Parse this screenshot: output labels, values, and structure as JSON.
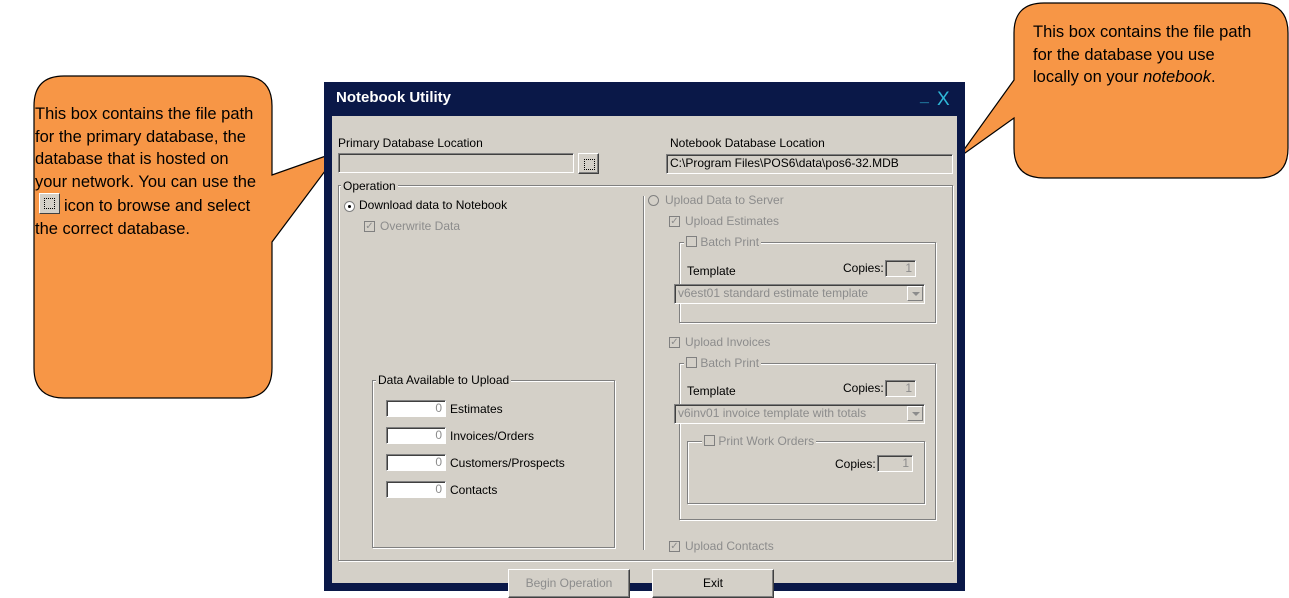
{
  "callouts": {
    "left": {
      "text_before_icon": "This box contains the file path for the primary database, the database that is hosted on your network. You can use the",
      "text_after_icon": "icon to browse and select the correct database.",
      "fill": "#f79646",
      "icon": "browse-icon"
    },
    "right": {
      "text": "This box contains the file path for the database you use locally on your",
      "emphasis": "notebook",
      "suffix": ".",
      "fill": "#f79646"
    }
  },
  "window": {
    "title": "Notebook Utility",
    "minimize": "_",
    "close": "X",
    "title_bar_color": "#0a1848"
  },
  "primary_db": {
    "label": "Primary Database Location",
    "value": ""
  },
  "notebook_db": {
    "label": "Notebook Database Location",
    "value": "C:\\Program Files\\POS6\\data\\pos6-32.MDB"
  },
  "operation": {
    "legend": "Operation",
    "download_label": "Download data to Notebook",
    "overwrite_label": "Overwrite Data",
    "upload_label": "Upload Data to Server"
  },
  "upload_estimates": {
    "label": "Upload Estimates",
    "batch_print_label": "Batch Print",
    "template_label": "Template",
    "copies_label": "Copies:",
    "copies_value": "1",
    "template_value": "v6est01 standard estimate template"
  },
  "upload_invoices": {
    "label": "Upload Invoices",
    "batch_print_label": "Batch Print",
    "template_label": "Template",
    "copies_label": "Copies:",
    "copies_value": "1",
    "template_value": "v6inv01 invoice template with totals",
    "work_orders_label": "Print Work Orders",
    "work_orders_copies_label": "Copies:",
    "work_orders_copies_value": "1"
  },
  "upload_contacts": {
    "label": "Upload Contacts"
  },
  "data_available": {
    "legend": "Data Available to Upload",
    "rows": [
      {
        "count": "0",
        "label": "Estimates"
      },
      {
        "count": "0",
        "label": "Invoices/Orders"
      },
      {
        "count": "0",
        "label": "Customers/Prospects"
      },
      {
        "count": "0",
        "label": "Contacts"
      }
    ]
  },
  "buttons": {
    "begin": "Begin Operation",
    "exit": "Exit"
  }
}
